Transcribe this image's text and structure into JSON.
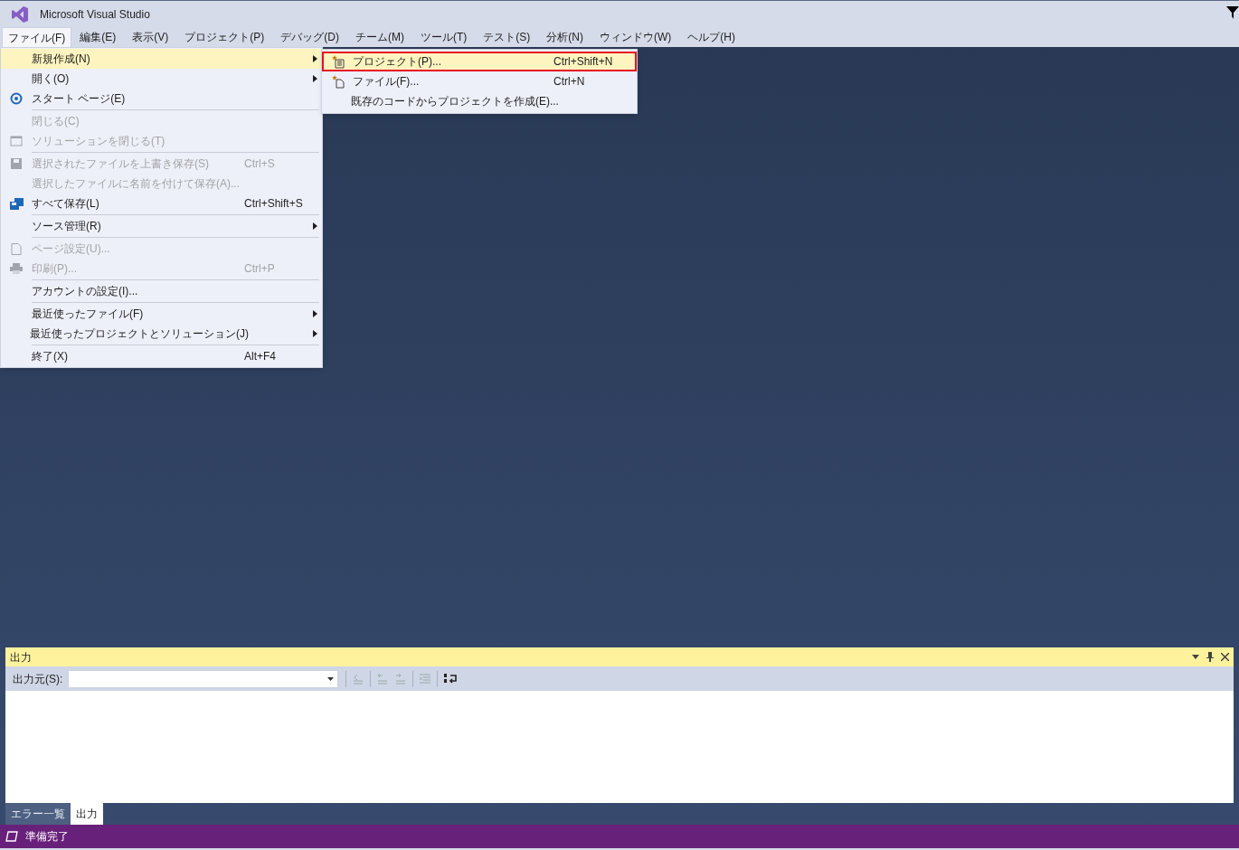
{
  "window": {
    "title": "Microsoft Visual Studio"
  },
  "menubar": [
    {
      "label": "ファイル(F)",
      "selected": true
    },
    {
      "label": "編集(E)",
      "selected": false
    },
    {
      "label": "表示(V)",
      "selected": false
    },
    {
      "label": "プロジェクト(P)",
      "selected": false
    },
    {
      "label": "デバッグ(D)",
      "selected": false
    },
    {
      "label": "チーム(M)",
      "selected": false
    },
    {
      "label": "ツール(T)",
      "selected": false
    },
    {
      "label": "テスト(S)",
      "selected": false
    },
    {
      "label": "分析(N)",
      "selected": false
    },
    {
      "label": "ウィンドウ(W)",
      "selected": false
    },
    {
      "label": "ヘルプ(H)",
      "selected": false
    }
  ],
  "file_menu": [
    {
      "kind": "item",
      "label": "新規作成(N)",
      "submenu": true,
      "disabled": false,
      "selected": true
    },
    {
      "kind": "item",
      "label": "開く(O)",
      "submenu": true,
      "disabled": false,
      "selected": false
    },
    {
      "kind": "item",
      "label": "スタート ページ(E)",
      "disabled": false,
      "selected": false
    },
    {
      "kind": "separator"
    },
    {
      "kind": "item",
      "label": "閉じる(C)",
      "disabled": true,
      "selected": false
    },
    {
      "kind": "item",
      "label": "ソリューションを閉じる(T)",
      "disabled": true,
      "selected": false
    },
    {
      "kind": "separator"
    },
    {
      "kind": "item",
      "label": "選択されたファイルを上書き保存(S)",
      "shortcut": "Ctrl+S",
      "disabled": true,
      "selected": false
    },
    {
      "kind": "item",
      "label": "選択したファイルに名前を付けて保存(A)...",
      "disabled": true,
      "selected": false
    },
    {
      "kind": "item",
      "label": "すべて保存(L)",
      "shortcut": "Ctrl+Shift+S",
      "disabled": false,
      "selected": false
    },
    {
      "kind": "separator"
    },
    {
      "kind": "item",
      "label": "ソース管理(R)",
      "submenu": true,
      "disabled": false,
      "selected": false
    },
    {
      "kind": "separator"
    },
    {
      "kind": "item",
      "label": "ページ設定(U)...",
      "disabled": true,
      "selected": false
    },
    {
      "kind": "item",
      "label": "印刷(P)...",
      "shortcut": "Ctrl+P",
      "disabled": true,
      "selected": false
    },
    {
      "kind": "separator"
    },
    {
      "kind": "item",
      "label": "アカウントの設定(I)...",
      "disabled": false,
      "selected": false
    },
    {
      "kind": "separator"
    },
    {
      "kind": "item",
      "label": "最近使ったファイル(F)",
      "submenu": true,
      "disabled": false,
      "selected": false
    },
    {
      "kind": "item",
      "label": "最近使ったプロジェクトとソリューション(J)",
      "submenu": true,
      "disabled": false,
      "selected": false
    },
    {
      "kind": "separator"
    },
    {
      "kind": "item",
      "label": "終了(X)",
      "shortcut": "Alt+F4",
      "disabled": false,
      "selected": false
    }
  ],
  "new_submenu": [
    {
      "label": "プロジェクト(P)...",
      "shortcut": "Ctrl+Shift+N",
      "selected": true
    },
    {
      "label": "ファイル(F)...",
      "shortcut": "Ctrl+N",
      "selected": false
    },
    {
      "label": "既存のコードからプロジェクトを作成(E)...",
      "selected": false
    }
  ],
  "output_panel": {
    "title": "出力",
    "source_label": "出力元(S):"
  },
  "bottom_tabs": [
    {
      "label": "エラー一覧",
      "selected": false
    },
    {
      "label": "出力",
      "selected": true
    }
  ],
  "status_bar": {
    "text": "準備完了"
  }
}
